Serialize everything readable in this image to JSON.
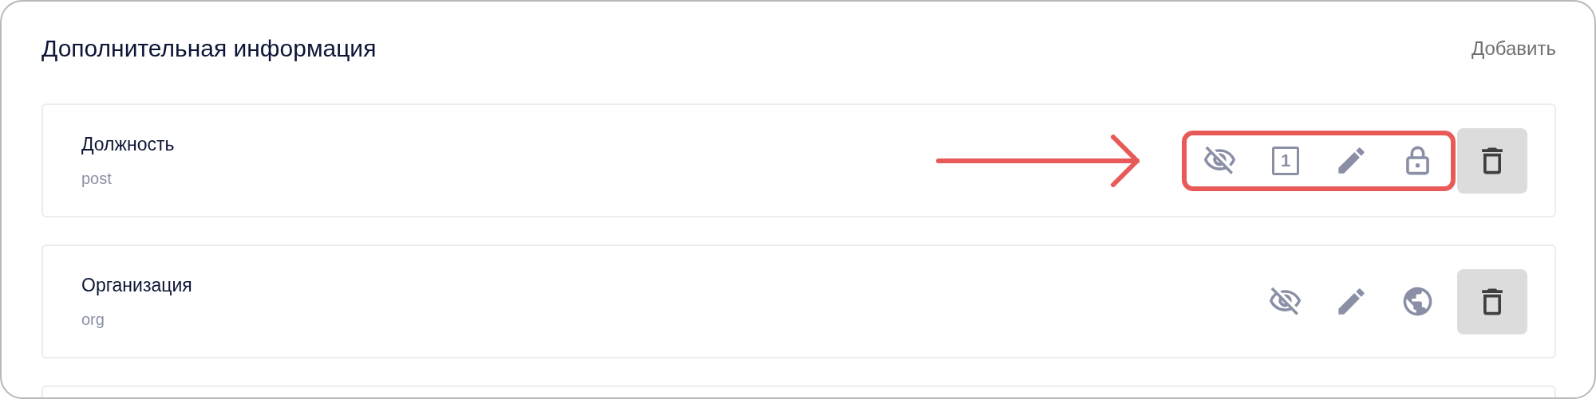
{
  "section": {
    "title": "Дополнительная информация",
    "add_link": "Добавить"
  },
  "fields": [
    {
      "name": "Должность",
      "key": "post",
      "highlighted": true,
      "icons": [
        {
          "kind": "eye-off"
        },
        {
          "kind": "number",
          "label": "1"
        },
        {
          "kind": "pencil"
        },
        {
          "kind": "lock"
        }
      ]
    },
    {
      "name": "Организация",
      "key": "org",
      "highlighted": false,
      "icons": [
        {
          "kind": "eye-off"
        },
        {
          "kind": "pencil"
        },
        {
          "kind": "globe"
        }
      ]
    }
  ]
}
